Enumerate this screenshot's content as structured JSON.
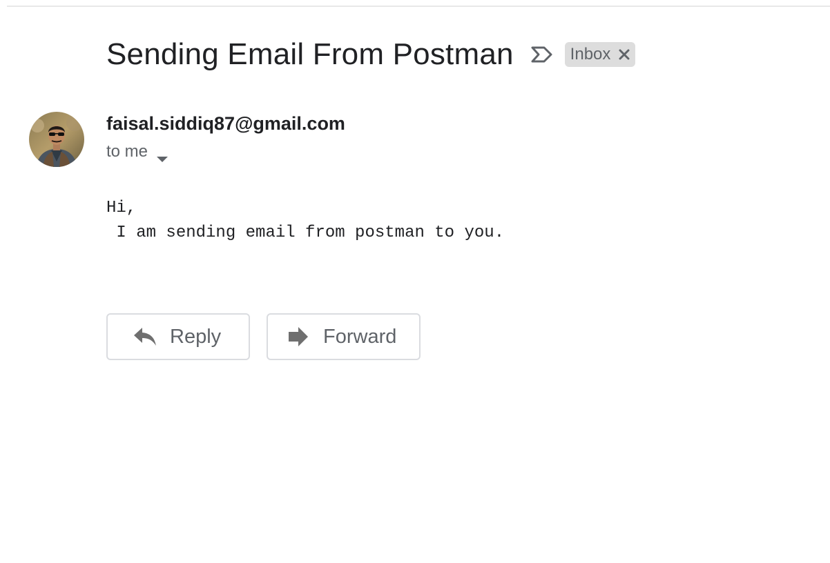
{
  "message": {
    "subject": "Sending Email From Postman",
    "label": "Inbox",
    "sender": "faisal.siddiq87@gmail.com",
    "recipient": "to me",
    "body_lines": [
      "Hi,",
      " I am sending email from postman to you."
    ]
  },
  "actions": {
    "reply_label": "Reply",
    "forward_label": "Forward"
  },
  "icons": {
    "importance": "importance-marker-icon",
    "label_remove": "close-icon",
    "recipient_details": "caret-down-icon",
    "reply": "reply-arrow-icon",
    "forward": "forward-arrow-icon"
  },
  "colors": {
    "text_primary": "#202124",
    "text_secondary": "#5f6368",
    "chip_background": "#dddddd",
    "button_border": "#dadce0",
    "icon_gray": "#6f6f6f"
  }
}
